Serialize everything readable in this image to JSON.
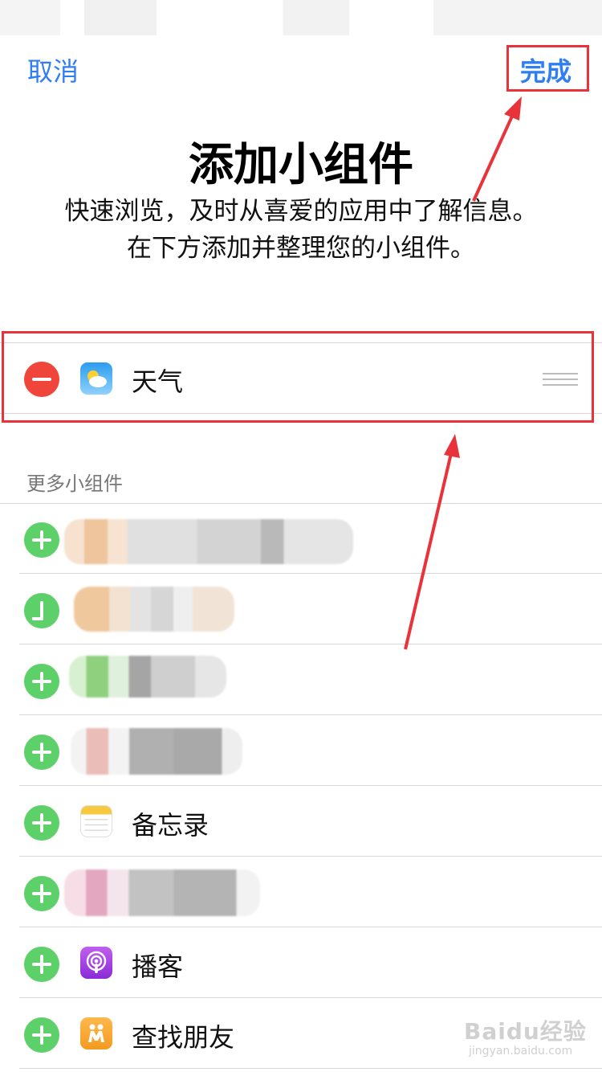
{
  "nav": {
    "cancel_label": "取消",
    "done_label": "完成"
  },
  "header": {
    "title": "添加小组件",
    "subtitle": "快速浏览，及时从喜爱的应用中了解信息。在下方添加并整理您的小组件。"
  },
  "active_widgets": [
    {
      "label": "天气",
      "icon": "weather-icon"
    }
  ],
  "more_widgets": {
    "section_title": "更多小组件",
    "items": [
      {
        "label": "",
        "icon": "blurred-icon"
      },
      {
        "label": "",
        "icon": "blurred-icon"
      },
      {
        "label": "",
        "icon": "blurred-icon"
      },
      {
        "label": "",
        "icon": "blurred-icon"
      },
      {
        "label": "备忘录",
        "icon": "notes-icon"
      },
      {
        "label": "",
        "icon": "blurred-icon"
      },
      {
        "label": "播客",
        "icon": "podcasts-icon"
      },
      {
        "label": "查找朋友",
        "icon": "find-friends-icon"
      }
    ]
  },
  "colors": {
    "accent": "#2f7ef2",
    "remove": "#f0453b",
    "add": "#5dd06a",
    "annotation": "#e9333a"
  },
  "watermark": {
    "brand": "Baidu经验",
    "url": "jingyan.baidu.com"
  }
}
